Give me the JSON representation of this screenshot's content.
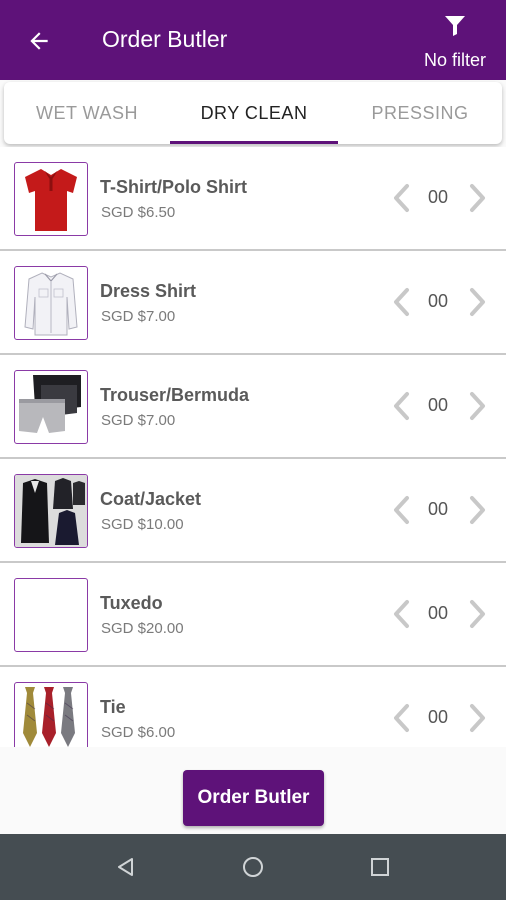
{
  "app_bar": {
    "title": "Order Butler",
    "filter_label": "No filter"
  },
  "tabs": [
    {
      "label": "WET WASH",
      "active": false
    },
    {
      "label": "DRY CLEAN",
      "active": true
    },
    {
      "label": "PRESSING",
      "active": false
    }
  ],
  "items": [
    {
      "name": "T-Shirt/Polo Shirt",
      "price": "SGD $6.50",
      "qty": "00",
      "image": "red-polo-shirt"
    },
    {
      "name": "Dress Shirt",
      "price": "SGD $7.00",
      "qty": "00",
      "image": "white-dress-shirt"
    },
    {
      "name": "Trouser/Bermuda",
      "price": "SGD $7.00",
      "qty": "00",
      "image": "shorts"
    },
    {
      "name": "Coat/Jacket",
      "price": "SGD $10.00",
      "qty": "00",
      "image": "coats"
    },
    {
      "name": "Tuxedo",
      "price": "SGD $20.00",
      "qty": "00",
      "image": "blank"
    },
    {
      "name": "Tie",
      "price": "SGD $6.00",
      "qty": "00",
      "image": "ties"
    }
  ],
  "footer": {
    "order_button_label": "Order Butler"
  },
  "colors": {
    "primary": "#5e1279",
    "nav_bar": "#454d52"
  }
}
